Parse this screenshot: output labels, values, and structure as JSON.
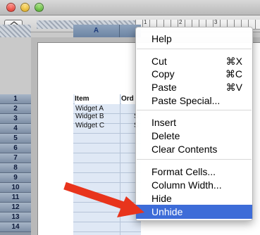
{
  "window": {
    "controls": [
      "close-button",
      "minimize-button",
      "zoom-button"
    ]
  },
  "ruler": {
    "numbers": [
      "1",
      "2",
      "3"
    ]
  },
  "columns": {
    "a": "A"
  },
  "rows": [
    "1",
    "2",
    "3",
    "4",
    "5",
    "6",
    "7",
    "8",
    "9",
    "10",
    "11",
    "12",
    "13",
    "14"
  ],
  "sheet": {
    "headers": {
      "item": "Item",
      "order": "Ord"
    },
    "items": [
      "Widget A",
      "Widget B",
      "Widget C"
    ],
    "order_partial": [
      "",
      "S",
      "S"
    ]
  },
  "context_menu": {
    "items": [
      {
        "label": "Help",
        "shortcut": ""
      },
      {
        "label": "Cut",
        "shortcut": "⌘X"
      },
      {
        "label": "Copy",
        "shortcut": "⌘C"
      },
      {
        "label": "Paste",
        "shortcut": "⌘V"
      },
      {
        "label": "Paste Special...",
        "shortcut": ""
      },
      {
        "label": "Insert",
        "shortcut": ""
      },
      {
        "label": "Delete",
        "shortcut": ""
      },
      {
        "label": "Clear Contents",
        "shortcut": ""
      },
      {
        "label": "Format Cells...",
        "shortcut": ""
      },
      {
        "label": "Column Width...",
        "shortcut": ""
      },
      {
        "label": "Hide",
        "shortcut": ""
      },
      {
        "label": "Unhide",
        "shortcut": ""
      }
    ],
    "highlighted": "Unhide"
  },
  "colors": {
    "highlight": "#3d6cd8",
    "arrow": "#e8341c",
    "header_blue": "#1c3a7a"
  }
}
